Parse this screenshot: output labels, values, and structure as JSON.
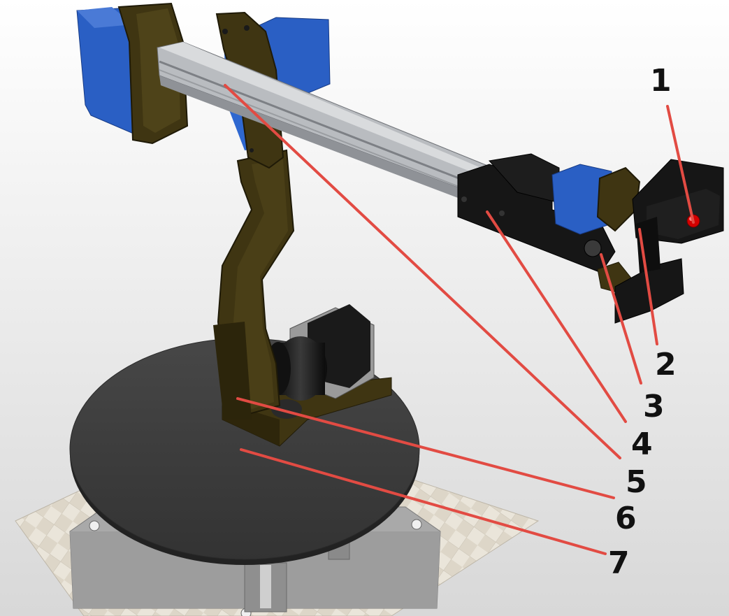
{
  "callouts": [
    {
      "label": "1"
    },
    {
      "label": "2"
    },
    {
      "label": "3"
    },
    {
      "label": "4"
    },
    {
      "label": "5"
    },
    {
      "label": "6"
    },
    {
      "label": "7"
    }
  ],
  "colors": {
    "background_top": "#ffffff",
    "background_bottom": "#d8d8d8",
    "servo_blue": "#2a5fc4",
    "bracket_brown": "#3f3512",
    "rail_gray": "#b9bcc0",
    "gripper_black": "#161616",
    "platter_dark": "#3c3c3c",
    "base_plate": "#a9a9a9",
    "floor_tile": "#ddd6c8",
    "leader_red": "#e24b43",
    "led_red": "#d40000"
  }
}
